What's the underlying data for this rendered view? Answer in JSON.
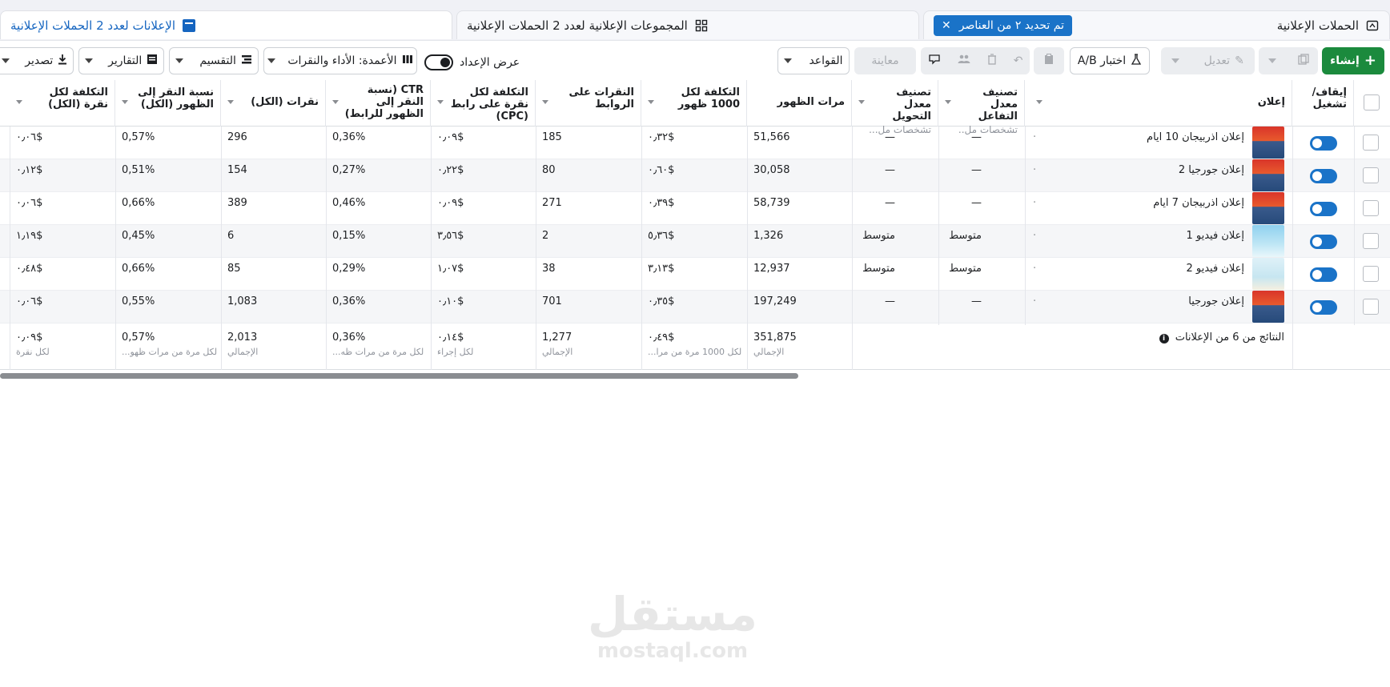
{
  "tabs": {
    "campaigns": "الحملات الإعلانية",
    "selection_chip": "تم تحديد ٢ من العناصر",
    "adsets": "المجموعات الإعلانية لعدد 2 الحملات الإعلانية",
    "ads": "الإعلانات لعدد 2 الحملات الإعلانية"
  },
  "toolbar": {
    "create": "إنشاء",
    "edit": "تعديل",
    "ab_test": "اختبار A/B",
    "preview": "معاينة",
    "rules": "القواعد",
    "setup_view": "عرض الإعداد",
    "columns": "الأعمدة: الأداء والنقرات",
    "breakdown": "التقسيم",
    "reports": "التقارير",
    "export": "تصدير"
  },
  "headers": {
    "on_off": "إيقاف/ تشغيل",
    "ad": "إعلان",
    "engagement_rank": "تصنيف معدل التفاعل",
    "engagement_sub": "تشخصات مل..",
    "conversion_rank": "تصنيف معدل التحويل",
    "conversion_sub": "تشخصات مل...",
    "impressions": "مرات الظهور",
    "cpm": "التكلفة لكل 1000 ظهور",
    "link_clicks": "النقرات على الروابط",
    "cpc": "التكلفة لكل نقرة على رابط (CPC)",
    "ctr": "CTR (نسبة النقر إلى الظهور للرابط)",
    "clicks_all": "نقرات (الكل)",
    "ctr_all": "نسبة النقر إلى الظهور (الكل)",
    "cpc_all": "التكلفة لكل نقرة (الكل)"
  },
  "rows": [
    {
      "name": "إعلان اذربيجان 10 ايام",
      "engagement": "—",
      "conversion": "—",
      "impressions": "51,566",
      "cpm": "٠٫٣٢$",
      "link_clicks": "185",
      "cpc": "٠٫٠٩$",
      "ctr": "0,36%",
      "clicks": "296",
      "ctr_all": "0,57%",
      "cpc_all": "٠٫٠٦$",
      "thumb": "red"
    },
    {
      "name": "إعلان جورجيا 2",
      "engagement": "—",
      "conversion": "—",
      "impressions": "30,058",
      "cpm": "٠٫٦٠$",
      "link_clicks": "80",
      "cpc": "٠٫٢٢$",
      "ctr": "0,27%",
      "clicks": "154",
      "ctr_all": "0,51%",
      "cpc_all": "٠٫١٢$",
      "thumb": "red"
    },
    {
      "name": "إعلان اذربيجان 7 ايام",
      "engagement": "—",
      "conversion": "—",
      "impressions": "58,739",
      "cpm": "٠٫٣٩$",
      "link_clicks": "271",
      "cpc": "٠٫٠٩$",
      "ctr": "0,46%",
      "clicks": "389",
      "ctr_all": "0,66%",
      "cpc_all": "٠٫٠٦$",
      "thumb": "red"
    },
    {
      "name": "إعلان فيديو 1",
      "engagement": "متوسط",
      "conversion": "متوسط",
      "impressions": "1,326",
      "cpm": "٥٫٣٦$",
      "link_clicks": "2",
      "cpc": "٣٫٥٦$",
      "ctr": "0,15%",
      "clicks": "6",
      "ctr_all": "0,45%",
      "cpc_all": "١٫١٩$",
      "thumb": "blue"
    },
    {
      "name": "إعلان فيديو 2",
      "engagement": "متوسط",
      "conversion": "متوسط",
      "impressions": "12,937",
      "cpm": "٣٫١٣$",
      "link_clicks": "38",
      "cpc": "١٫٠٧$",
      "ctr": "0,29%",
      "clicks": "85",
      "ctr_all": "0,66%",
      "cpc_all": "٠٫٤٨$",
      "thumb": "light"
    },
    {
      "name": "إعلان جورجيا",
      "engagement": "—",
      "conversion": "—",
      "impressions": "197,249",
      "cpm": "٠٫٣٥$",
      "link_clicks": "701",
      "cpc": "٠٫١٠$",
      "ctr": "0,36%",
      "clicks": "1,083",
      "ctr_all": "0,55%",
      "cpc_all": "٠٫٠٦$",
      "thumb": "red"
    }
  ],
  "totals": {
    "label": "النتائج من 6 من الإعلانات",
    "impressions": "351,875",
    "impressions_sub": "الإجمالي",
    "cpm": "٠٫٤٩$",
    "cpm_sub": "لكل 1000 مرة من مرا...",
    "link_clicks": "1,277",
    "link_clicks_sub": "الإجمالي",
    "cpc": "٠٫١٤$",
    "cpc_sub": "لكل إجراء",
    "ctr": "0,36%",
    "ctr_sub": "لكل مرة من مرات ظه...",
    "clicks": "2,013",
    "clicks_sub": "الإجمالي",
    "ctr_all": "0,57%",
    "ctr_all_sub": "لكل مرة من مرات ظهو...",
    "cpc_all": "٠٫٠٩$",
    "cpc_all_sub": "لكل نقرة"
  },
  "watermark": {
    "arabic": "مستقل",
    "latin": "mostaql.com"
  },
  "colors": {
    "primary_green": "#1b8a3d",
    "accent_blue": "#1a73c8",
    "link_blue": "#1565c0"
  }
}
